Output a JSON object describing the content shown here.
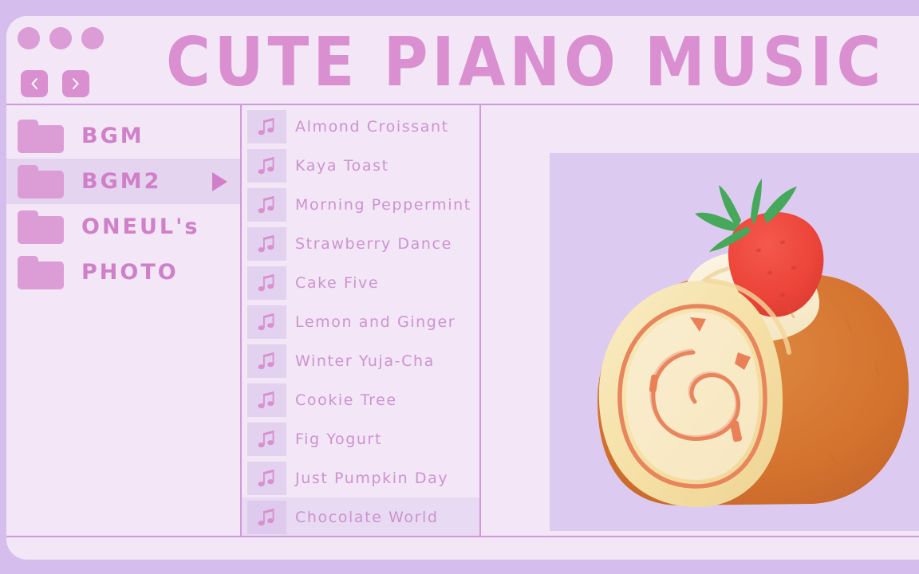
{
  "window": {
    "title": "CUTE PIANO MUSIC",
    "traffic_lights": [
      "dot-1",
      "dot-2",
      "dot-3"
    ],
    "nav": {
      "back_icon": "chevron-left-icon",
      "forward_icon": "chevron-right-icon"
    }
  },
  "sidebar": {
    "items": [
      {
        "label": "BGM",
        "icon": "folder-icon",
        "selected": false
      },
      {
        "label": "BGM2",
        "icon": "folder-icon",
        "selected": true,
        "indicator": "play-triangle-icon"
      },
      {
        "label": "ONEUL's",
        "icon": "folder-icon",
        "selected": false
      },
      {
        "label": "PHOTO",
        "icon": "folder-icon",
        "selected": false
      }
    ]
  },
  "tracklist": {
    "icon": "music-note-icon",
    "tracks": [
      {
        "title": "Almond Croissant",
        "selected": false
      },
      {
        "title": "Kaya Toast",
        "selected": false
      },
      {
        "title": "Morning Peppermint",
        "selected": false
      },
      {
        "title": "Strawberry Dance",
        "selected": false
      },
      {
        "title": "Cake Five",
        "selected": false
      },
      {
        "title": "Lemon and Ginger",
        "selected": false
      },
      {
        "title": "Winter Yuja-Cha",
        "selected": false
      },
      {
        "title": "Cookie Tree",
        "selected": false
      },
      {
        "title": "Fig Yogurt",
        "selected": false
      },
      {
        "title": "Just Pumpkin Day",
        "selected": false
      },
      {
        "title": "Chocolate World",
        "selected": true
      }
    ]
  },
  "preview": {
    "artwork": "swiss-roll-cake-with-strawberry-illustration"
  },
  "colors": {
    "desktop_background": "#d5bdee",
    "window_background": "#f2e6f7",
    "accent_pink": "#d98fd0",
    "folder_pink": "#dc9cd6",
    "text_pink": "#d080c8",
    "track_text": "#cd93d0",
    "divider": "#cf9ad9",
    "selection": "#e5d4f0",
    "art_backdrop": "#ddcaf0",
    "cake_crust": "#d4722e",
    "cake_sponge": "#f6e2ae",
    "cake_cream": "#fbf3e2",
    "strawberry_red": "#ef4a42",
    "strawberry_leaf": "#46a85a",
    "swirl_line": "#e8855c"
  }
}
